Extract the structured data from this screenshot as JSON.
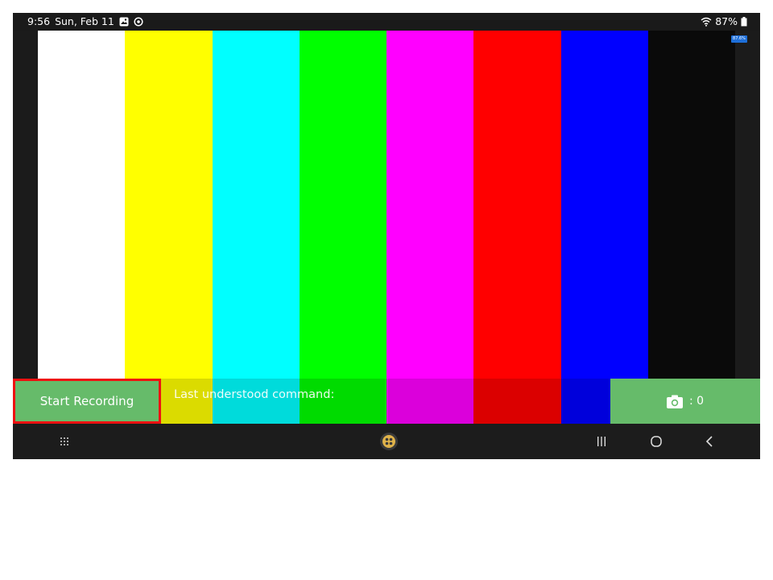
{
  "status_bar": {
    "time": "9:56",
    "date": "Sun, Feb 11",
    "battery": "87%",
    "icons": [
      "gallery-icon",
      "sync-icon",
      "wifi-icon",
      "battery-icon"
    ]
  },
  "video": {
    "bar_colors": [
      "#ffffff",
      "#ffff00",
      "#00ffff",
      "#00ff00",
      "#ff00ff",
      "#ff0000",
      "#0000ff",
      "#0a0a0a"
    ],
    "battery_chip": "87.6%"
  },
  "controls": {
    "record_label": "Start Recording",
    "last_command_label": "Last understood command:",
    "photo_count": ": 0",
    "accent_color": "#66bb6a",
    "highlight_color": "#ee1111"
  },
  "nav_bar": {
    "icons": [
      "app-drawer-icon",
      "assistant-icon",
      "recents-icon",
      "home-icon",
      "back-icon"
    ]
  }
}
